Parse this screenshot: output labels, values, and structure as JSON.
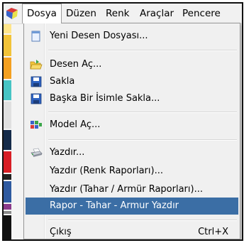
{
  "menubar": {
    "items": [
      "Dosya",
      "Düzen",
      "Renk",
      "Araçlar",
      "Pencere"
    ]
  },
  "palette": [
    "#ffe58a",
    "#f2c338",
    "#f4a020",
    "#46c4c4",
    "#e0e0e0",
    "#162c4a",
    "#d81e25",
    "#222222",
    "#2f5aa0",
    "#8a3a8a",
    "#8a8a8a",
    "#111111"
  ],
  "menu": {
    "items": [
      {
        "label": "Yeni Desen Dosyası...",
        "icon": "new-file-icon"
      },
      {
        "label": "Desen Aç...",
        "icon": "open-folder-icon"
      },
      {
        "label": "Sakla",
        "icon": "save-disk-icon"
      },
      {
        "label": "Başka Bir İsimle Sakla...",
        "icon": "save-as-disk-icon"
      },
      {
        "label": "Model Aç...",
        "icon": "model-icon"
      },
      {
        "label": "Yazdır...",
        "icon": "printer-icon"
      },
      {
        "label": "Yazdır (Renk Raporları)..."
      },
      {
        "label": "Yazdır (Tahar / Armür Raporları)..."
      },
      {
        "label": "Rapor - Tahar - Armur Yazdır",
        "selected": true
      },
      {
        "label": "Çıkış",
        "shortcut": "Ctrl+X"
      }
    ]
  },
  "colors": {
    "selection": "#3b6ea5",
    "menu_bg": "#f0f0f0"
  }
}
